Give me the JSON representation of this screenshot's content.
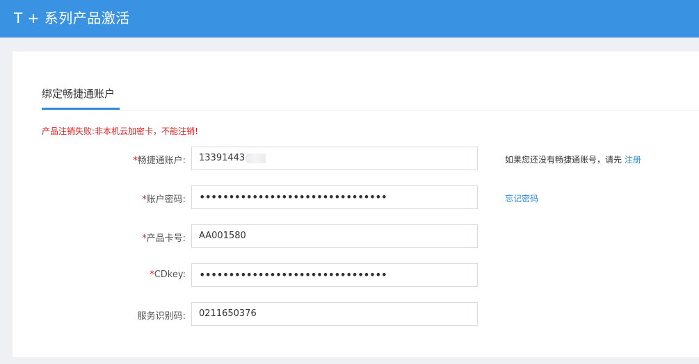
{
  "header": {
    "title": "T + 系列产品激活"
  },
  "tabs": [
    {
      "label": "绑定畅捷通账户"
    }
  ],
  "error_message": "产品注销失败:非本机云加密卡，不能注销!",
  "form": {
    "account": {
      "required_mark": "*",
      "label": "畅捷通账户:",
      "value": "13391443",
      "hint": "如果您还没有畅捷通账号，请先",
      "hint_link": "注册"
    },
    "password": {
      "required_mark": "*",
      "label": "账户密码:",
      "value": "••••••••••••••••••••••••••••••••",
      "link": "忘记密码"
    },
    "card_number": {
      "required_mark": "*",
      "label": "产品卡号:",
      "value": "AA001580"
    },
    "cdkey": {
      "required_mark": "*",
      "label": "CDkey:",
      "value": "••••••••••••••••••••••••••••••••"
    },
    "service_code": {
      "label": "服务识别码:",
      "value": "0211650376"
    }
  },
  "colors": {
    "header_bg": "#3a93e2",
    "accent": "#2f89d8",
    "error": "#e02020"
  }
}
